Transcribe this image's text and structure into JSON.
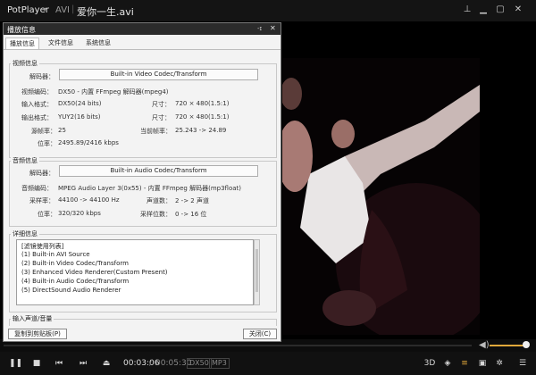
{
  "titlebar": {
    "app_name": "PotPlayer",
    "format": "AVI",
    "file_name": "爱你一生.avi",
    "pin_icon": "pin-icon",
    "restore_icon": "restore-icon",
    "maximize_icon": "maximize-icon",
    "close_icon": "close-icon"
  },
  "dialog": {
    "title": "播放信息",
    "tabs": [
      "播放信息",
      "文件信息",
      "系统信息"
    ],
    "active_tab": 0,
    "video": {
      "section_title": "视频信息",
      "decoder_label": "解码器：",
      "decoder_button": "Built-in Video Codec/Transform",
      "codec_label": "视频编码：",
      "codec_value": "DX50 - 内置 FFmpeg 解码器(mpeg4)",
      "input_format_label": "输入格式：",
      "input_format_value": "DX50(24 bits)",
      "input_size_label": "尺寸：",
      "input_size_value": "720 × 480(1.5:1)",
      "output_format_label": "输出格式：",
      "output_format_value": "YUY2(16 bits)",
      "output_size_label": "尺寸：",
      "output_size_value": "720 × 480(1.5:1)",
      "fps_label": "源帧率：",
      "fps_value": "25",
      "current_fps_label": "当前帧率：",
      "current_fps_value": "25.243 -> 24.89",
      "bitrate_label": "位率：",
      "bitrate_value": "2495.89/2416 kbps"
    },
    "audio": {
      "section_title": "音频信息",
      "decoder_label": "解码器：",
      "decoder_button": "Built-in Audio Codec/Transform",
      "codec_label": "音频编码：",
      "codec_value": "MPEG Audio Layer 3(0x55) - 内置 FFmpeg 解码器(mp3float)",
      "samplerate_label": "采样率：",
      "samplerate_value": "44100 -> 44100 Hz",
      "channels_label": "声道数：",
      "channels_value": "2 -> 2 声道",
      "bitrate_label": "位率：",
      "bitrate_value": "320/320 kbps",
      "bits_label": "采样位数：",
      "bits_value": "0 -> 16 位"
    },
    "detail": {
      "section_title": "详细信息",
      "lines": [
        "[滤镜使用列表]",
        "(1) Built-in AVI Source",
        "(2) Built-in Video Codec/Transform",
        "(3) Enhanced Video Renderer(Custom Present)",
        "(4) Built-in Audio Codec/Transform",
        "(5) DirectSound Audio Renderer"
      ]
    },
    "input_section_title": "输入声道/音量",
    "copy_button": "复制到剪贴板(P)",
    "close_button": "关闭(C)"
  },
  "controls": {
    "current_time": "00:03:06",
    "separator": "/",
    "total_time": "00:05:30",
    "video_badge": "DX50",
    "audio_badge": "MP3",
    "volume_level": 0.85
  }
}
